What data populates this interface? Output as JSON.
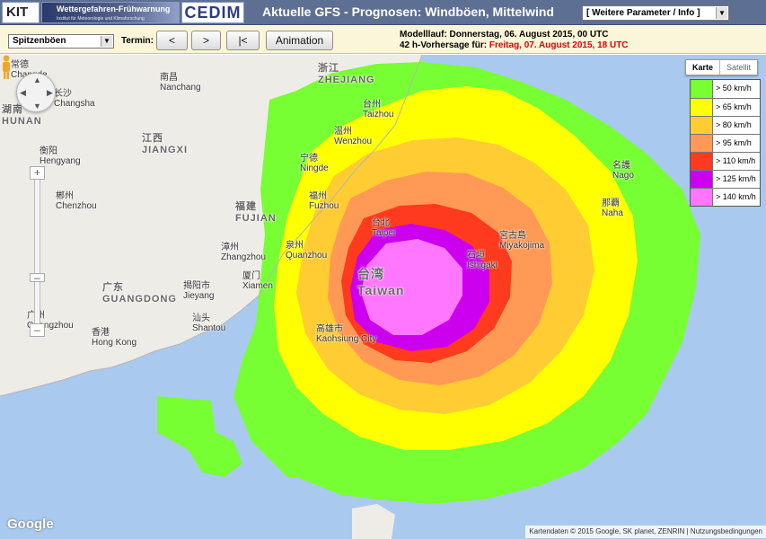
{
  "header": {
    "kit_logo": "KIT",
    "banner_title": "Wettergefahren-Frühwarnung",
    "banner_sub": "Institut für Meteorologie und Klimaforschung",
    "edim_logo": "CEDIM",
    "title": "Aktuelle GFS - Prognosen: Windböen, Mittelwind",
    "param_select": "[ Weitere Parameter / Info ]"
  },
  "toolbar": {
    "field_select": "Spitzenböen",
    "termin_label": "Termin:",
    "prev_label": "<",
    "next_label": ">",
    "first_label": "|<",
    "animation_label": "Animation",
    "model_run": "Modelllauf: Donnerstag, 06. August 2015, 00 UTC",
    "forecast_prefix": "42 h-Vorhersage für:",
    "forecast_time": "Freitag, 07. August 2015, 18 UTC",
    "forecast_color": "#e00000"
  },
  "map": {
    "maptype_map": "Karte",
    "maptype_satellite": "Satellit",
    "labels": {
      "changde": "常德",
      "changde_en": "Changde",
      "changsha": "长沙",
      "changsha_en": "Changsha",
      "hunan": "湖南",
      "hunan_en": "HUNAN",
      "nanchang": "南昌",
      "nanchang_en": "Nanchang",
      "zhejiang": "浙江",
      "zhejiang_en": "ZHEJIANG",
      "taizhou": "台州",
      "taizhou_en": "Taizhou",
      "wenzhou": "温州",
      "wenzhou_en": "Wenzhou",
      "jiangxi": "江西",
      "jiangxi_en": "JIANGXI",
      "hengyang": "衡阳",
      "hengyang_en": "Hengyang",
      "ningde": "宁德",
      "ningde_en": "Ningde",
      "fuzhou": "福州",
      "fuzhou_en": "Fuzhou",
      "fujian": "福建",
      "fujian_en": "FUJIAN",
      "chenzhou": "郴州",
      "chenzhou_en": "Chenzhou",
      "taipei": "台北",
      "taipei_en": "Taipei",
      "zhangzhou": "漳州",
      "zhangzhou_en": "Zhangzhou",
      "quanzhou": "泉州",
      "quanzhou_en": "Quanzhou",
      "xiamen": "厦门",
      "xiamen_en": "Xiamen",
      "guangdong": "广东",
      "guangdong_en": "GUANGDONG",
      "jieyang": "揭阳市",
      "jieyang_en": "Jieyang",
      "taiwan": "台湾",
      "taiwan_en": "Taiwan",
      "shantou": "汕头",
      "shantou_en": "Shantou",
      "guangzhou": "广州",
      "guangzhou_en": "Guangzhou",
      "hongkong": "香港",
      "hongkong_en": "Hong Kong",
      "kaohsiung": "高雄市",
      "kaohsiung_en": "Kaohsiung City",
      "ishigaki": "石垣",
      "ishigaki_en": "Ishigaki",
      "miyakojima": "宮古島",
      "miyakojima_en": "Miyakojima",
      "nago": "名護",
      "nago_en": "Nago",
      "naha": "那覇",
      "naha_en": "Naha"
    },
    "legend": [
      {
        "label": "> 50 km/h",
        "color": "#77ff33"
      },
      {
        "label": "> 65 km/h",
        "color": "#ffff00"
      },
      {
        "label": "> 80 km/h",
        "color": "#ffcc33"
      },
      {
        "label": "> 95 km/h",
        "color": "#ff9955"
      },
      {
        "label": "> 110 km/h",
        "color": "#ff3a1e"
      },
      {
        "label": "> 125 km/h",
        "color": "#cc00ee"
      },
      {
        "label": "> 140 km/h",
        "color": "#ff77ff"
      }
    ],
    "google_logo": "Google",
    "attribution": "Kartendaten © 2015 Google, SK planet, ZENRIN",
    "terms": "Nutzungsbedingungen"
  }
}
